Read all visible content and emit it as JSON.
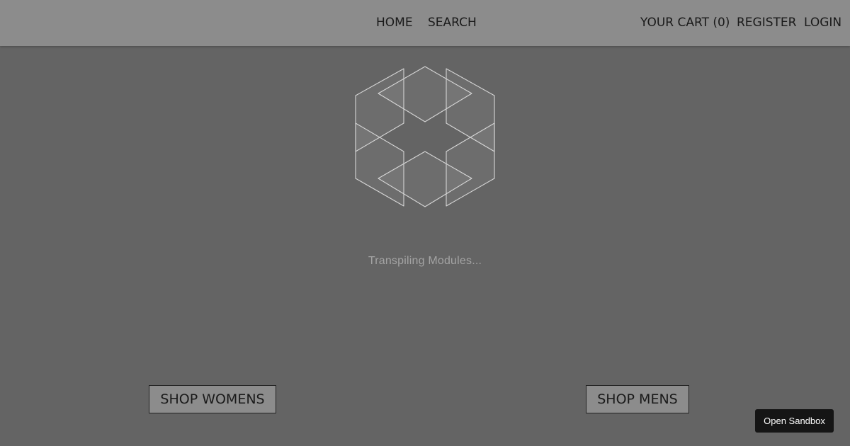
{
  "nav": {
    "home": "HOME",
    "search": "SEARCH",
    "cart": "YOUR CART (0)",
    "register": "REGISTER",
    "login": "LOGIN"
  },
  "loader": {
    "icon": "sandbox-cube-logo-icon",
    "status_text": "Transpiling Modules..."
  },
  "buttons": {
    "shop_womens": "SHOP WOMENS",
    "shop_mens": "SHOP MENS",
    "open_sandbox": "Open Sandbox"
  },
  "colors": {
    "background": "#646464",
    "navbar": "#8c8c8c",
    "sandbox_button": "#151515"
  }
}
